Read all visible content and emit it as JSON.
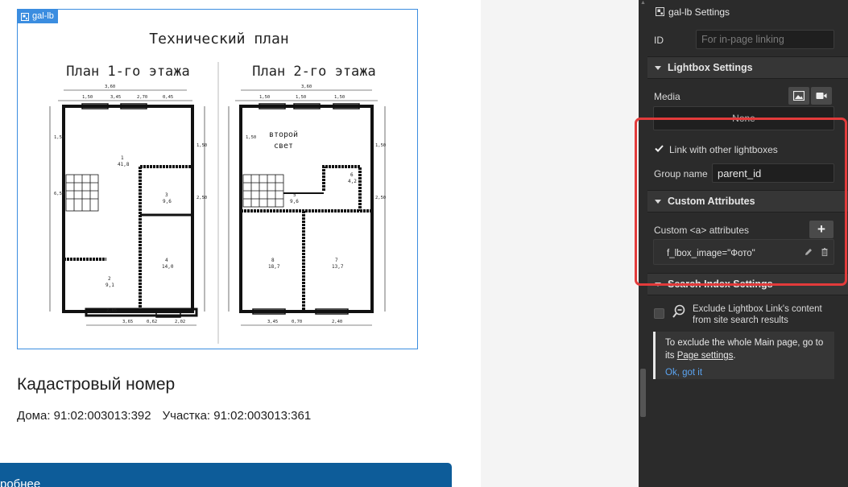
{
  "canvas": {
    "element_badge": "gal-lb",
    "plan": {
      "title": "Технический план",
      "floor1_label": "План 1-го этажа",
      "floor2_label": "План 2-го этажа",
      "second_light_line1": "второй",
      "second_light_line2": "свет",
      "room_labels_floor1": [
        "1\n41,8",
        "2\n9,1",
        "3\n9,6",
        "4\n14,0"
      ],
      "room_labels_floor2": [
        "5\n9,6",
        "6\n4,2",
        "7\n13,7",
        "8\n18,7"
      ]
    },
    "cadastral_title": "Кадастровый номер",
    "house_number": "Дома: 91:02:003013:392",
    "plot_number": "Участка: 91:02:003013:361",
    "more_button": "робнее"
  },
  "panel": {
    "element_settings_title": "gal-lb Settings",
    "id_label": "ID",
    "id_placeholder": "For in-page linking",
    "lightbox_section": "Lightbox Settings",
    "media_label": "Media",
    "media_value": "None",
    "link_checkbox_label": "Link with other lightboxes",
    "link_checked": true,
    "group_name_label": "Group name",
    "group_name_value": "parent_id",
    "custom_attributes_section": "Custom Attributes",
    "custom_a_label": "Custom <a> attributes",
    "add_attr_symbol": "+",
    "attribute_value": "f_lbox_image=\"Фото\"",
    "search_index_section": "Search Index Settings",
    "exclude_label": "Exclude Lightbox Link's content from site search results",
    "exclude_checked": false,
    "info_prefix": "To exclude the whole Main page, go to its",
    "info_link": "Page settings",
    "info_suffix": ".",
    "ok_link": "Ok, got it"
  },
  "colors": {
    "panel_bg": "#2b2b2b",
    "selection_blue": "#3b8de0",
    "annotation_red": "#e33b3b",
    "cta_blue": "#0d5c99"
  }
}
